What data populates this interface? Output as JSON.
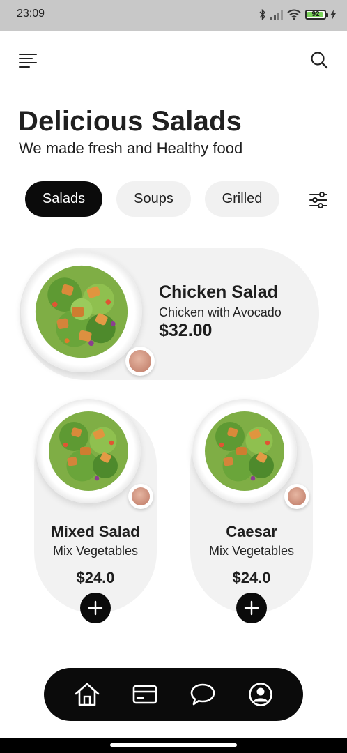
{
  "status_bar": {
    "time": "23:09",
    "battery": "92"
  },
  "header": {
    "title": "Delicious Salads",
    "subtitle": "We made fresh and Healthy food"
  },
  "tabs": [
    {
      "label": "Salads",
      "active": true
    },
    {
      "label": "Soups",
      "active": false
    },
    {
      "label": "Grilled",
      "active": false
    }
  ],
  "featured": {
    "name": "Chicken Salad",
    "description": "Chicken with Avocado",
    "price": "$32.00"
  },
  "items": [
    {
      "name": "Mixed Salad",
      "description": "Mix Vegetables",
      "price": "$24.0"
    },
    {
      "name": "Caesar",
      "description": "Mix Vegetables",
      "price": "$24.0"
    }
  ],
  "icons": {
    "menu": "menu-icon",
    "search": "search-icon",
    "filter": "sliders-icon",
    "add": "plus-icon",
    "home": "home-icon",
    "card": "card-icon",
    "chat": "chat-icon",
    "profile": "profile-icon"
  },
  "colors": {
    "accent": "#0b0b0b",
    "card_bg": "#f2f2f2",
    "pill_bg": "#f1f1f1",
    "status_bar": "#c8c8c8",
    "battery": "#7ad35a"
  }
}
